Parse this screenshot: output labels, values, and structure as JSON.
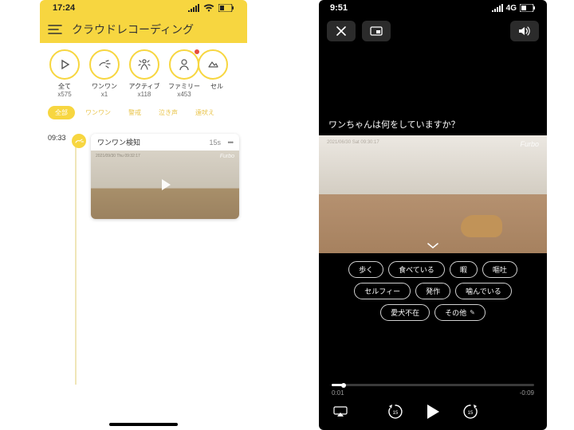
{
  "left": {
    "status": {
      "time": "17:24"
    },
    "header": {
      "title": "クラウドレコーディング"
    },
    "tiles": [
      {
        "label": "全て",
        "count": "x575",
        "iconName": "play-icon"
      },
      {
        "label": "ワンワン",
        "count": "x1",
        "iconName": "bark-icon"
      },
      {
        "label": "アクティブ",
        "count": "x118",
        "iconName": "active-icon"
      },
      {
        "label": "ファミリー",
        "count": "x453",
        "iconName": "family-icon",
        "notif": true
      },
      {
        "label": "セル",
        "count": "",
        "iconName": "selfie-icon"
      }
    ],
    "chips": [
      {
        "label": "全部",
        "active": true
      },
      {
        "label": "ワンワン",
        "active": false
      },
      {
        "label": "警戒",
        "active": false
      },
      {
        "label": "泣き声",
        "active": false
      },
      {
        "label": "遠吠え",
        "active": false
      }
    ],
    "entry": {
      "time": "09:33",
      "title": "ワンワン検知",
      "duration": "15s",
      "watermark": "Furbo",
      "timestamp": "2021/09/30 Thu 09:32:17"
    }
  },
  "right": {
    "status": {
      "time": "9:51",
      "network": "4G"
    },
    "question": "ワンちゃんは何をしていますか？",
    "video": {
      "watermark": "Furbo",
      "timestamp": "2021/06/30 Sat 09:30:17"
    },
    "tags": [
      {
        "label": "歩く"
      },
      {
        "label": "食べている"
      },
      {
        "label": "暇"
      },
      {
        "label": "嘔吐"
      },
      {
        "label": "セルフィー"
      },
      {
        "label": "発作"
      },
      {
        "label": "噛んでいる"
      },
      {
        "label": "愛犬不在"
      },
      {
        "label": "その他",
        "editable": true
      }
    ],
    "scrubber": {
      "elapsed": "0:01",
      "remaining": "-0:09"
    }
  }
}
